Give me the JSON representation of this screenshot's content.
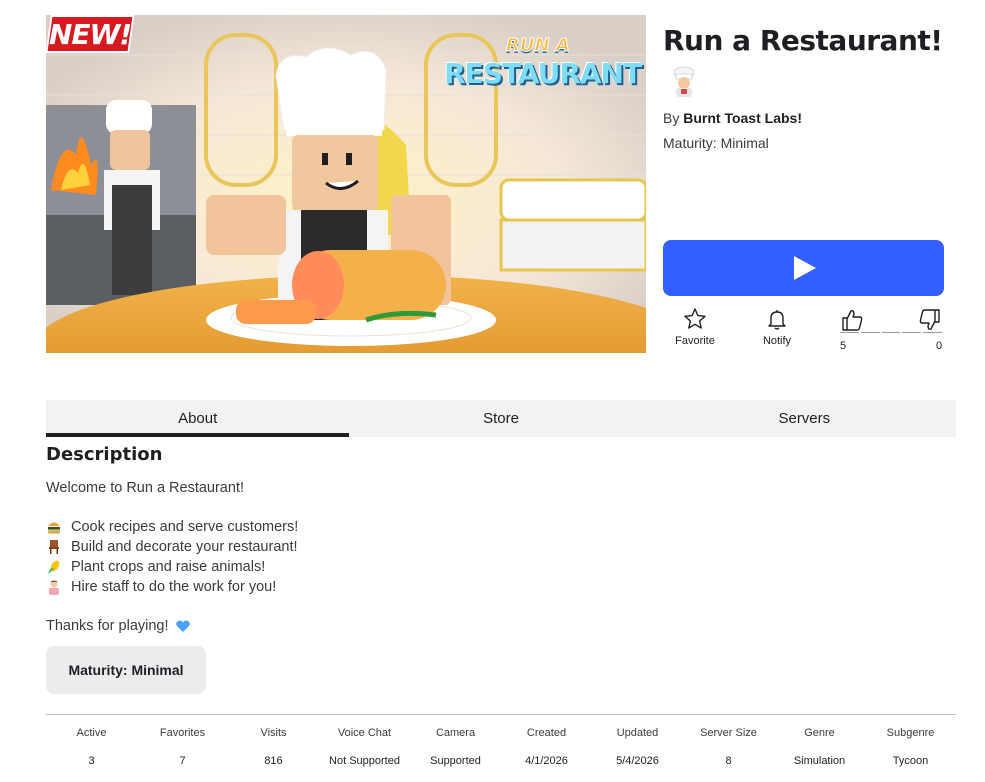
{
  "thumbnail": {
    "badge": "NEW!",
    "logo_top": "RUN A",
    "logo_bottom": "RESTAURANT"
  },
  "game": {
    "title": "Run a Restaurant!",
    "title_emoji_icon": "chef-emoji",
    "by_prefix": "By",
    "creator": "Burnt Toast Labs!",
    "maturity": "Maturity: Minimal"
  },
  "actions": {
    "favorite_label": "Favorite",
    "notify_label": "Notify",
    "upvotes": "5",
    "downvotes": "0"
  },
  "tabs": [
    {
      "label": "About",
      "active": true
    },
    {
      "label": "Store",
      "active": false
    },
    {
      "label": "Servers",
      "active": false
    }
  ],
  "description": {
    "heading": "Description",
    "intro": "Welcome to Run a Restaurant!",
    "bullets": [
      {
        "icon": "burger-emoji",
        "text": "Cook recipes and serve customers!"
      },
      {
        "icon": "chair-emoji",
        "text": "Build and decorate your restaurant!"
      },
      {
        "icon": "corn-emoji",
        "text": "Plant crops and raise animals!"
      },
      {
        "icon": "worker-emoji",
        "text": "Hire staff to do the work for you!"
      }
    ],
    "outro": "Thanks for playing!",
    "outro_icon": "blue-heart-emoji"
  },
  "maturity_box": "Maturity: Minimal",
  "stats": [
    {
      "label": "Active",
      "value": "3"
    },
    {
      "label": "Favorites",
      "value": "7"
    },
    {
      "label": "Visits",
      "value": "816"
    },
    {
      "label": "Voice Chat",
      "value": "Not Supported"
    },
    {
      "label": "Camera",
      "value": "Supported"
    },
    {
      "label": "Created",
      "value": "4/1/2026"
    },
    {
      "label": "Updated",
      "value": "5/4/2026"
    },
    {
      "label": "Server Size",
      "value": "8"
    },
    {
      "label": "Genre",
      "value": "Simulation"
    },
    {
      "label": "Subgenre",
      "value": "Tycoon"
    }
  ],
  "colors": {
    "play_button": "#335fff",
    "badge_red": "#d71920",
    "heart": "#4aa3ff"
  }
}
